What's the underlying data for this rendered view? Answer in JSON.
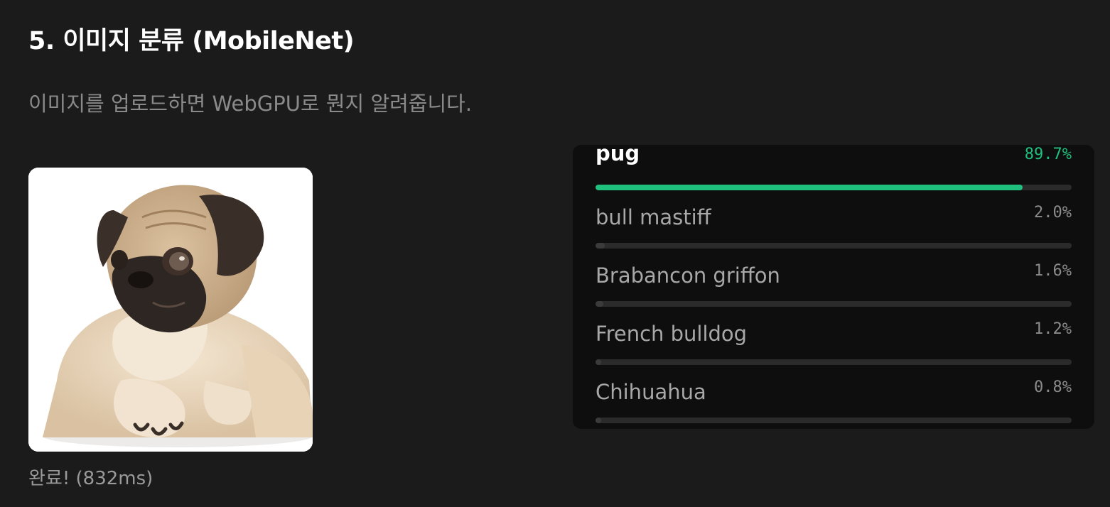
{
  "header": {
    "title": "5. 이미지 분류 (MobileNet)",
    "subtitle": "이미지를 업로드하면 WebGPU로 뭔지 알려줍니다."
  },
  "image": {
    "icon": "pug-photo"
  },
  "status": {
    "text": "완료! (832ms)"
  },
  "results": {
    "colors": {
      "top": "#1fbf7e",
      "track": "#2b2b2b",
      "fill": "#3b3b3b"
    },
    "items": [
      {
        "label": "pug",
        "percent_text": "89.7%",
        "value": 0.897
      },
      {
        "label": "bull mastiff",
        "percent_text": "2.0%",
        "value": 0.02
      },
      {
        "label": "Brabancon griffon",
        "percent_text": "1.6%",
        "value": 0.016
      },
      {
        "label": "French bulldog",
        "percent_text": "1.2%",
        "value": 0.012
      },
      {
        "label": "Chihuahua",
        "percent_text": "0.8%",
        "value": 0.008
      }
    ]
  }
}
